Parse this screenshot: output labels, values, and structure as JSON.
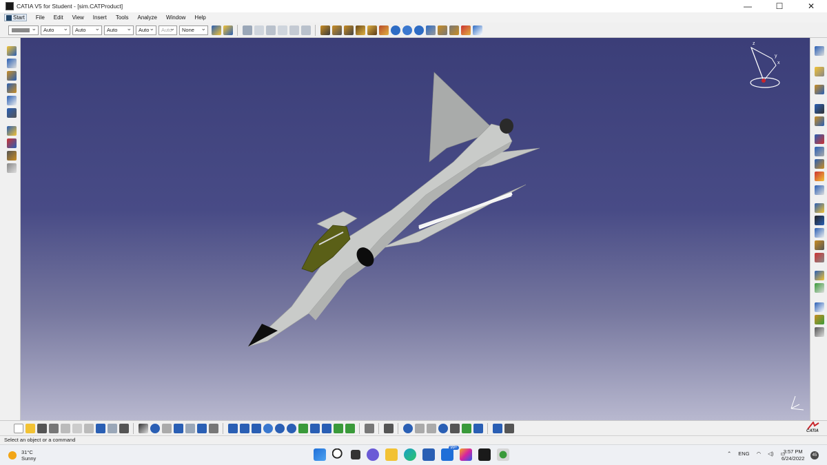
{
  "window": {
    "title": "CATIA V5 for Student - [sim.CATProduct]",
    "controls": {
      "minimize": "—",
      "maximize": "☐",
      "close": "✕"
    }
  },
  "menu": {
    "items": [
      {
        "label": "Start"
      },
      {
        "label": "File"
      },
      {
        "label": "Edit"
      },
      {
        "label": "View"
      },
      {
        "label": "Insert"
      },
      {
        "label": "Tools"
      },
      {
        "label": "Analyze"
      },
      {
        "label": "Window"
      },
      {
        "label": "Help"
      }
    ]
  },
  "graphic_properties": {
    "linetype": "Auto",
    "thickness": "Auto",
    "point_style": "Auto",
    "layer": "Auto",
    "rendering": "Auto",
    "layer_filter": "None",
    "color": "#8a8a8a"
  },
  "compass": {
    "x_label": "x",
    "y_label": "y",
    "z_label": "z"
  },
  "status": {
    "message": "Select an object or a command"
  },
  "bottom_logo": {
    "text": "CATIA"
  },
  "taskbar": {
    "weather_temp": "31°C",
    "weather_desc": "Sunny",
    "language": "ENG",
    "mail_badge": "99+",
    "time": "3:57 PM",
    "date": "6/24/2022",
    "notifications": "45",
    "tray_chevron": "⌃",
    "tray_wifi": "◠",
    "tray_volume": "◁)",
    "tray_battery": "▭"
  },
  "colors": {
    "viewport_top": "#3b3e78",
    "viewport_bottom": "#b8b8cf",
    "aircraft_body": "#c7c9c7",
    "canopy": "#5a5f17"
  }
}
